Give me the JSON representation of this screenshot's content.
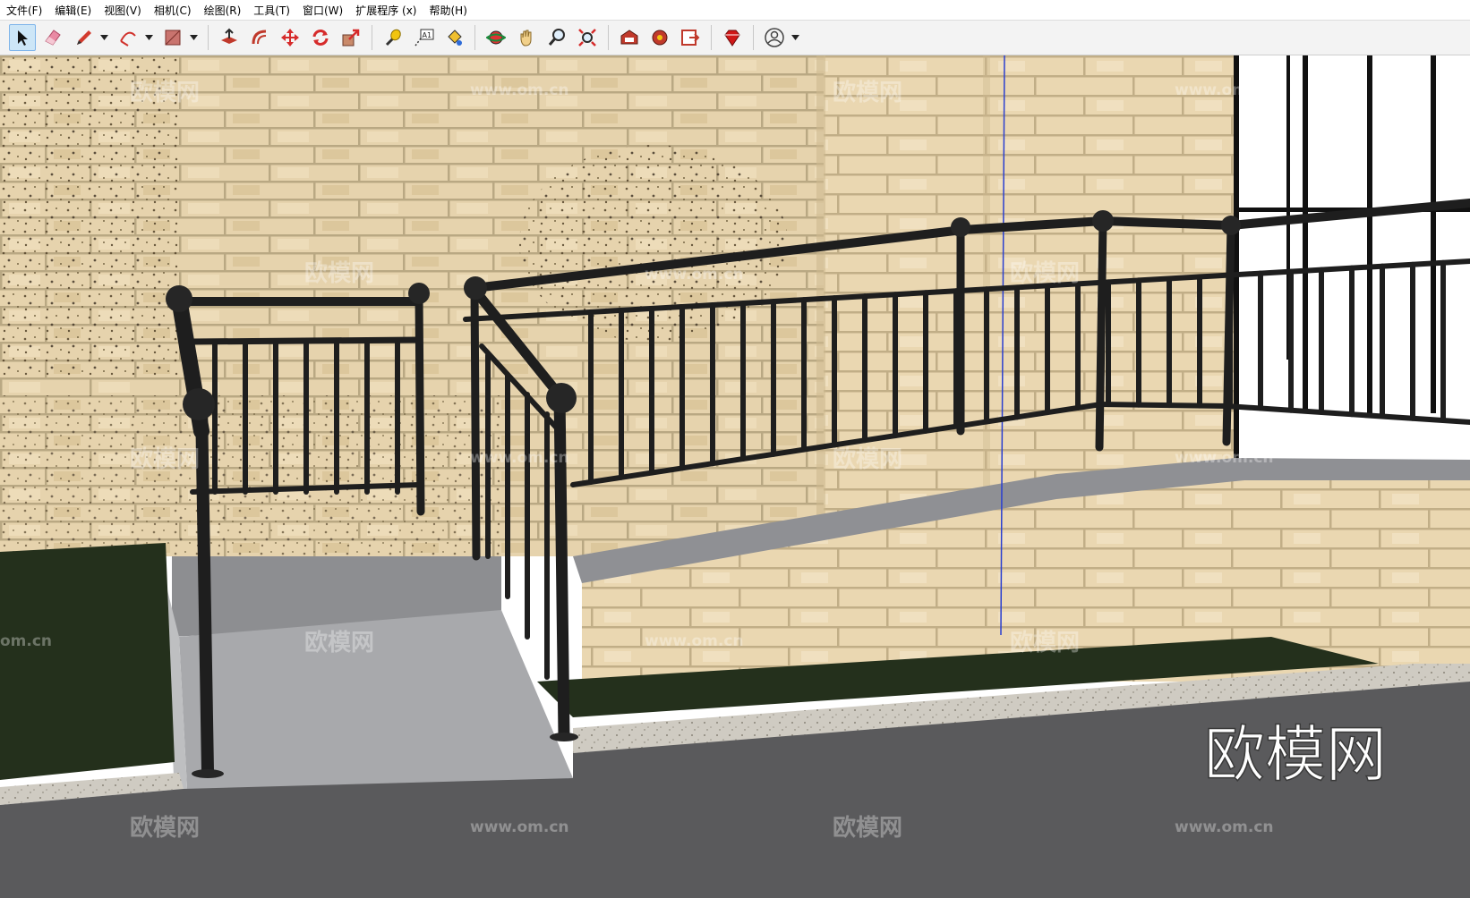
{
  "menubar": {
    "items": [
      {
        "label": "文件(F)"
      },
      {
        "label": "编辑(E)"
      },
      {
        "label": "视图(V)"
      },
      {
        "label": "相机(C)"
      },
      {
        "label": "绘图(R)"
      },
      {
        "label": "工具(T)"
      },
      {
        "label": "窗口(W)"
      },
      {
        "label": "扩展程序 (x)"
      },
      {
        "label": "帮助(H)"
      }
    ]
  },
  "toolbar": {
    "tools": [
      "select-tool-icon",
      "eraser-tool-icon",
      "pencil-tool-icon",
      "arc-tool-icon",
      "shape-tool-icon",
      "push-pull-tool-icon",
      "offset-tool-icon",
      "move-tool-icon",
      "rotate-tool-icon",
      "scale-tool-icon",
      "tape-measure-tool-icon",
      "text-tool-icon",
      "paint-bucket-tool-icon",
      "orbit-tool-icon",
      "pan-tool-icon",
      "zoom-tool-icon",
      "zoom-extents-tool-icon",
      "warehouse-icon",
      "extension-warehouse-icon",
      "layout-icon",
      "ruby-console-icon",
      "account-icon"
    ],
    "text_tool_glyph": "A1"
  },
  "watermarks": {
    "brand": "欧模网",
    "site": "www.om.cn",
    "partial_site": "om.cn"
  },
  "colors": {
    "accent": "#cde6f7",
    "railing": "#1e1e1e",
    "brick": "#e7d3aa",
    "ground": "#5a5a5c",
    "grass": "#24301c"
  }
}
